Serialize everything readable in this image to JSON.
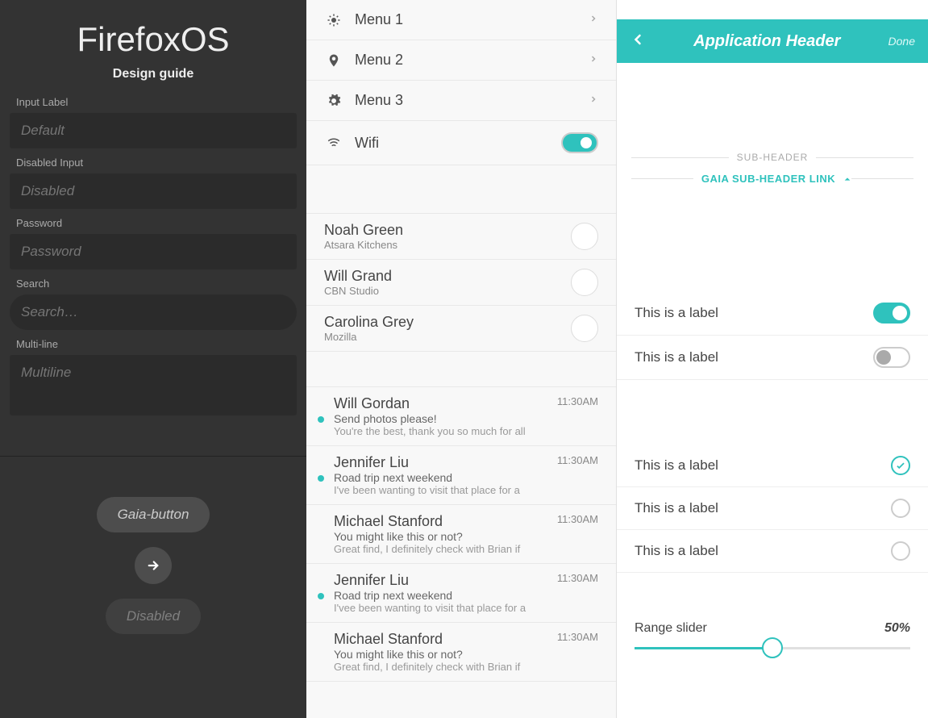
{
  "left": {
    "title": "FirefoxOS",
    "subtitle": "Design guide",
    "inputs": {
      "label1": "Input Label",
      "ph1": "Default",
      "label2": "Disabled Input",
      "ph2": "Disabled",
      "label3": "Password",
      "ph3": "Password",
      "label4": "Search",
      "ph4": "Search…",
      "label5": "Multi-line",
      "ph5": "Multiline"
    },
    "buttons": {
      "main": "Gaia-button",
      "disabled": "Disabled"
    }
  },
  "mid": {
    "menu": [
      {
        "label": "Menu 1",
        "icon": "sun"
      },
      {
        "label": "Menu 2",
        "icon": "pin"
      },
      {
        "label": "Menu 3",
        "icon": "gear"
      }
    ],
    "wifi": "Wifi",
    "contacts": [
      {
        "name": "Noah Green",
        "org": "Atsara Kitchens"
      },
      {
        "name": "Will Grand",
        "org": "CBN Studio"
      },
      {
        "name": "Carolina Grey",
        "org": "Mozilla"
      }
    ],
    "messages": [
      {
        "name": "Will Gordan",
        "sub": "Send photos please!",
        "body": "You're the best, thank you so much for all",
        "time": "11:30AM",
        "unread": true
      },
      {
        "name": "Jennifer Liu",
        "sub": "Road trip next weekend",
        "body": "I've been wanting to visit that place for a",
        "time": "11:30AM",
        "unread": true
      },
      {
        "name": "Michael Stanford",
        "sub": "You might like this or not?",
        "body": "Great find, I definitely check with Brian if",
        "time": "11:30AM",
        "unread": false
      },
      {
        "name": "Jennifer Liu",
        "sub": "Road trip next weekend",
        "body": "I'vee been wanting to visit that place for a",
        "time": "11:30AM",
        "unread": true
      },
      {
        "name": "Michael Stanford",
        "sub": "You might like this or not?",
        "body": "Great find, I definitely check with Brian if",
        "time": "11:30AM",
        "unread": false
      }
    ]
  },
  "right": {
    "header": {
      "title": "Application Header",
      "done": "Done"
    },
    "subheader": "SUB-HEADER",
    "subheaderLink": "GAIA SUB-HEADER LINK",
    "switches": [
      {
        "label": "This is a label",
        "on": true
      },
      {
        "label": "This is a label",
        "on": false
      }
    ],
    "checks": [
      {
        "label": "This is a label",
        "on": true
      },
      {
        "label": "This is a label",
        "on": false
      },
      {
        "label": "This is a label",
        "on": false
      }
    ],
    "slider": {
      "label": "Range slider",
      "value": "50%"
    }
  }
}
